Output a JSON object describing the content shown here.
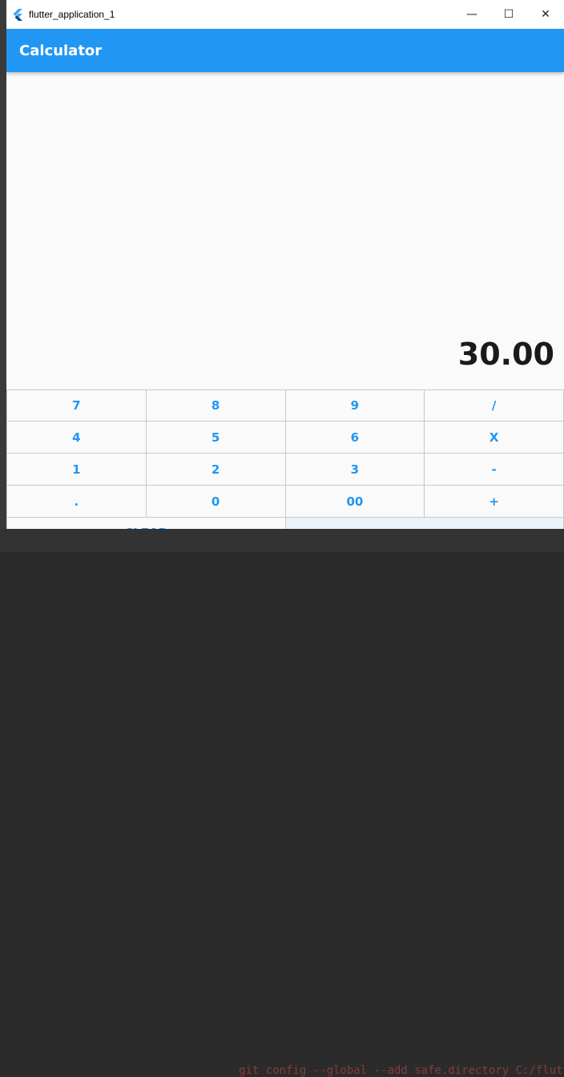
{
  "window": {
    "title": "flutter_application_1",
    "controls": {
      "minimize": "—",
      "maximize": "☐",
      "close": "✕"
    }
  },
  "appbar": {
    "title": "Calculator"
  },
  "display": {
    "value": "30.00"
  },
  "keypad": {
    "rows": [
      [
        "7",
        "8",
        "9",
        "/"
      ],
      [
        "4",
        "5",
        "6",
        "X"
      ],
      [
        "1",
        "2",
        "3",
        "-"
      ],
      [
        ".",
        "0",
        "00",
        "+"
      ]
    ],
    "clear_label": "CLEAR",
    "equals_label": "="
  },
  "background": {
    "terminal_text": "git config --global --add safe.directory C:/flutter"
  },
  "colors": {
    "accent": "#2196f3",
    "equals_bg": "#eaf2fb"
  },
  "icons": {
    "app": "flutter-logo-icon"
  }
}
